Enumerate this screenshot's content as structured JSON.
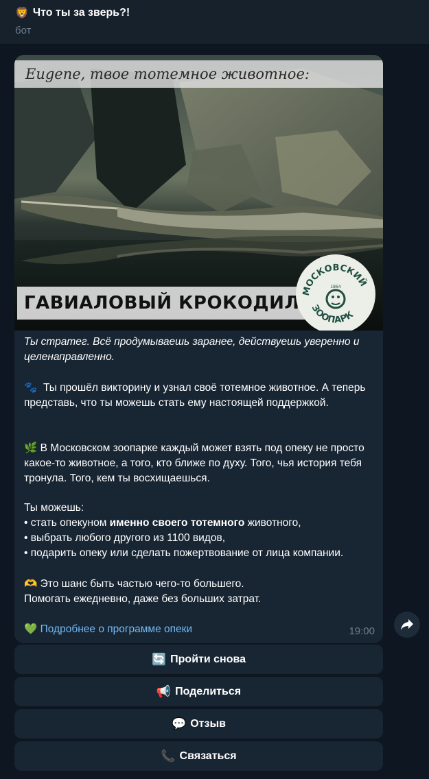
{
  "header": {
    "emoji": "🦁",
    "title": "Что ты за зверь?!",
    "subtitle": "бот"
  },
  "message": {
    "photo": {
      "caption_top": "Eugene, твое тотемное животное:",
      "animal_label": "ГАВИАЛОВЫЙ КРОКОДИЛ",
      "logo": {
        "text_top": "МОСКОВСКИЙ",
        "text_bottom": "ЗООПАРК",
        "year": "1864",
        "color": "#1f4f41"
      }
    },
    "intro": "Ты стратег. Всё продумываешь заранее, действуешь уверенно и целенаправленно.",
    "p1_icon": "🐾",
    "p1": "Ты прошёл викторину и узнал своё тотемное животное. А теперь представь, что ты можешь стать ему настоящей поддержкой.",
    "p2_icon": "🌿",
    "p2": "В Московском зоопарке каждый может взять под опеку не просто какое-то животное, а того, кто ближе по духу. Того, чья история тебя тронула. Того, кем ты восхищаешься.",
    "list_title": "Ты можешь:",
    "list_1_pre": "• стать опекуном ",
    "list_1_bold": "именно своего тотемного",
    "list_1_post": " животного,",
    "list_2": "• выбрать любого другого из 1100 видов,",
    "list_3": "• подарить опеку или сделать пожертвование от лица компании.",
    "p3_icon": "🫶",
    "p3_line1": "Это шанс быть частью чего-то большего.",
    "p3_line2": "Помогать ежедневно, даже без больших затрат.",
    "link_icon": "💚",
    "link_text": "Подробнее о программе опеки",
    "time": "19:00"
  },
  "buttons": [
    {
      "icon": "🔄",
      "label": "Пройти снова"
    },
    {
      "icon": "📢",
      "label": "Поделиться"
    },
    {
      "icon": "💬",
      "label": "Отзыв"
    },
    {
      "icon": "📞",
      "label": "Связаться"
    }
  ],
  "colors": {
    "background": "#0e1621",
    "bubble": "#182533",
    "header": "#17212b",
    "link": "#71baf5",
    "muted": "#6d7f8f"
  }
}
